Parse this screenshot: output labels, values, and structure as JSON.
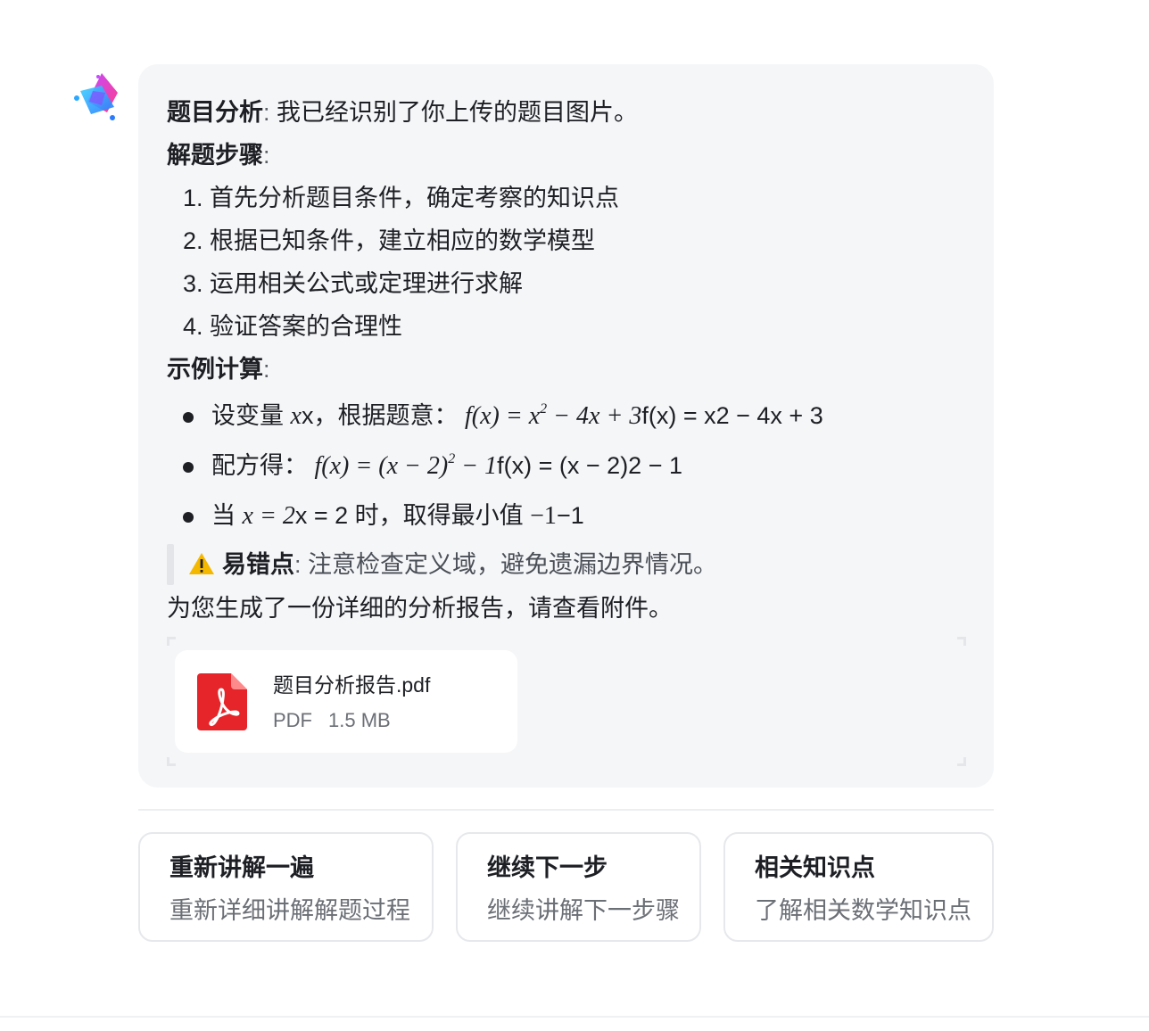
{
  "message": {
    "analysis_label": "题目分析",
    "colon": ":",
    "analysis_text": "我已经识别了你上传的题目图片。",
    "steps_label": "解题步骤",
    "steps": [
      "1. 首先分析题目条件，确定考察的知识点",
      "2. 根据已知条件，建立相应的数学模型",
      "3. 运用相关公式或定理进行求解",
      "4. 验证答案的合理性"
    ],
    "example_label": "示例计算",
    "bullet1": {
      "prefix": "设变量 ",
      "math_var": "x",
      "plain_var": "x，根据题意：",
      "math_fx": "f(x) = x",
      "math_sup": "2",
      "math_rest": " − 4x + 3",
      "plain_tail": "f(x) = x2 − 4x + 3"
    },
    "bullet2": {
      "prefix": "配方得：",
      "math_fx": "f(x) = (x − 2)",
      "math_sup": "2",
      "math_rest": " − 1",
      "plain_tail": "f(x) = (x − 2)2 − 1"
    },
    "bullet3": {
      "prefix": "当 ",
      "math_x": "x = 2",
      "plain_x": "x = 2 时，取得最小值 ",
      "math_min": "−1",
      "plain_min": "−1"
    },
    "warning_label": "易错点",
    "warning_text": "注意检查定义域，避免遗漏边界情况。",
    "report_text": "为您生成了一份详细的分析报告，请查看附件。"
  },
  "attachment": {
    "file_name": "题目分析报告.pdf",
    "file_type": "PDF",
    "file_size": "1.5 MB"
  },
  "actions": [
    {
      "title": "重新讲解一遍",
      "subtitle": "重新详细讲解解题过程"
    },
    {
      "title": "继续下一步",
      "subtitle": "继续讲解下一步骤"
    },
    {
      "title": "相关知识点",
      "subtitle": "了解相关数学知识点"
    }
  ],
  "colors": {
    "bubble_bg": "#f5f6f8",
    "pdf_red": "#e5252a",
    "warning_yellow": "#f5b800"
  },
  "icons": [
    "assistant-star-logo",
    "warning-icon",
    "pdf-icon"
  ]
}
